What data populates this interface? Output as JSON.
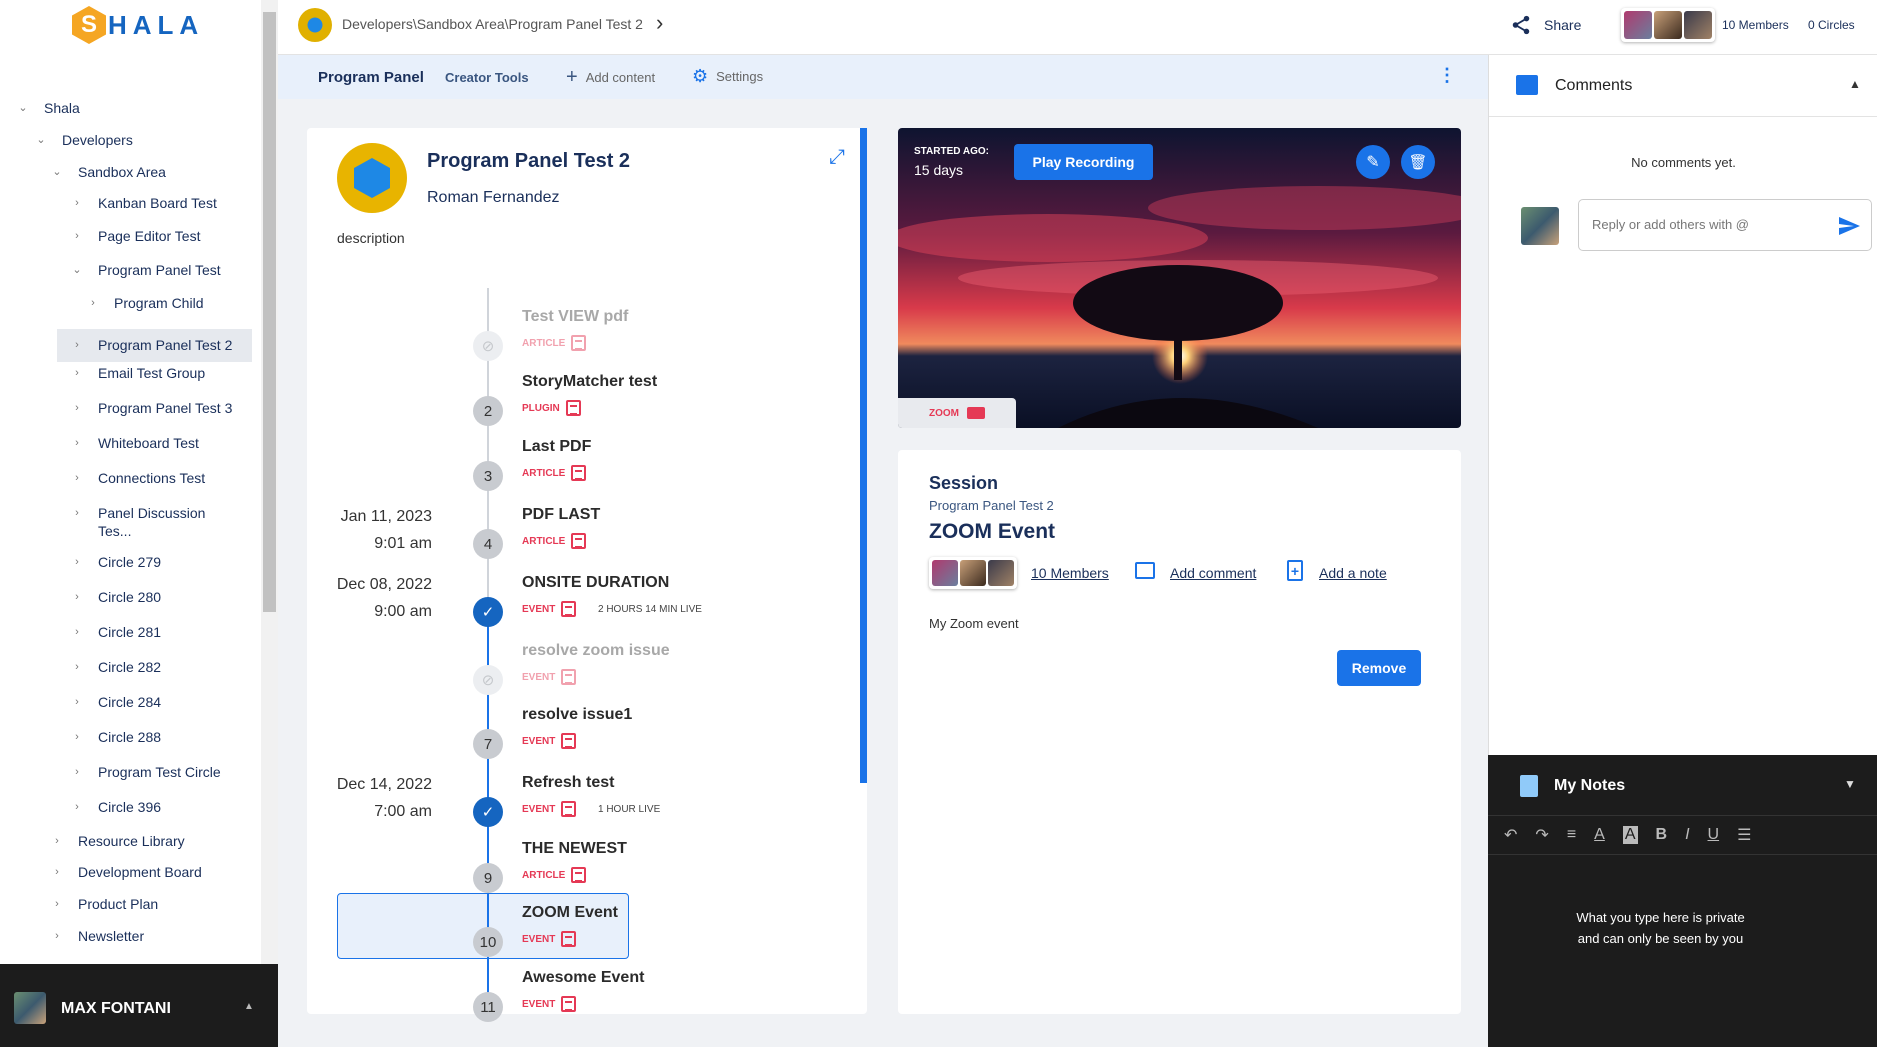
{
  "logo": {
    "mark": "S",
    "text": "HALA"
  },
  "sidebar": {
    "items": [
      {
        "label": "Shala",
        "chev": "⌄"
      },
      {
        "label": "Developers",
        "chev": "⌄"
      },
      {
        "label": "Sandbox Area",
        "chev": "⌄"
      },
      {
        "label": "Kanban Board Test",
        "chev": "›"
      },
      {
        "label": "Page Editor Test",
        "chev": "›"
      },
      {
        "label": "Program Panel Test",
        "chev": "⌄"
      },
      {
        "label": "Program Child",
        "chev": "›"
      },
      {
        "label": "Program Panel Test 2",
        "chev": "›"
      },
      {
        "label": "Email Test Group",
        "chev": "›"
      },
      {
        "label": "Program Panel Test 3",
        "chev": "›"
      },
      {
        "label": "Whiteboard Test",
        "chev": "›"
      },
      {
        "label": "Connections Test",
        "chev": "›"
      },
      {
        "label": "Panel Discussion Tes...",
        "chev": "›"
      },
      {
        "label": "Circle 279",
        "chev": "›"
      },
      {
        "label": "Circle 280",
        "chev": "›"
      },
      {
        "label": "Circle 281",
        "chev": "›"
      },
      {
        "label": "Circle 282",
        "chev": "›"
      },
      {
        "label": "Circle 284",
        "chev": "›"
      },
      {
        "label": "Circle 288",
        "chev": "›"
      },
      {
        "label": "Program Test Circle",
        "chev": "›"
      },
      {
        "label": "Circle 396",
        "chev": "›"
      },
      {
        "label": "Resource Library",
        "chev": "›"
      },
      {
        "label": "Development Board",
        "chev": "›"
      },
      {
        "label": "Product Plan",
        "chev": "›"
      },
      {
        "label": "Newsletter",
        "chev": "›"
      }
    ]
  },
  "user": {
    "name": "MAX FONTANI",
    "caret": "▲"
  },
  "topbar": {
    "breadcrumb": "Developers\\Sandbox Area\\Program Panel Test 2",
    "breadcrumb_chev": "›",
    "share": "Share",
    "members": "10 Members",
    "circles": "0 Circles"
  },
  "toolbar": {
    "tab_program_panel": "Program Panel",
    "tab_creator_tools": "Creator Tools",
    "add_content": "Add content",
    "settings": "Settings",
    "more": "⋮"
  },
  "program": {
    "title": "Program Panel Test 2",
    "author": "Roman Fernandez",
    "description": "description"
  },
  "timeline": [
    {
      "num": "",
      "title": "Test VIEW pdf",
      "type": "ARTICLE",
      "state": "hidden",
      "date": "",
      "time": "",
      "live": ""
    },
    {
      "num": "2",
      "title": "StoryMatcher test",
      "type": "PLUGIN",
      "state": "num",
      "date": "",
      "time": "",
      "live": ""
    },
    {
      "num": "3",
      "title": "Last PDF",
      "type": "ARTICLE",
      "state": "num",
      "date": "",
      "time": "",
      "live": ""
    },
    {
      "num": "4",
      "title": "PDF LAST",
      "type": "ARTICLE",
      "state": "num",
      "date": "Jan 11, 2023",
      "time": "9:01 am",
      "live": ""
    },
    {
      "num": "",
      "title": "ONSITE DURATION",
      "type": "EVENT",
      "state": "check",
      "date": "Dec 08, 2022",
      "time": "9:00 am",
      "live": "2 HOURS 14 MIN LIVE"
    },
    {
      "num": "",
      "title": "resolve zoom issue",
      "type": "EVENT",
      "state": "hidden",
      "date": "",
      "time": "",
      "live": ""
    },
    {
      "num": "7",
      "title": "resolve issue1",
      "type": "EVENT",
      "state": "num",
      "date": "",
      "time": "",
      "live": ""
    },
    {
      "num": "",
      "title": "Refresh test",
      "type": "EVENT",
      "state": "check",
      "date": "Dec 14, 2022",
      "time": "7:00 am",
      "live": "1 HOUR LIVE"
    },
    {
      "num": "9",
      "title": "THE NEWEST",
      "type": "ARTICLE",
      "state": "num",
      "date": "",
      "time": "",
      "live": ""
    },
    {
      "num": "10",
      "title": "ZOOM Event",
      "type": "EVENT",
      "state": "num",
      "date": "",
      "time": "",
      "live": ""
    },
    {
      "num": "11",
      "title": "Awesome Event",
      "type": "EVENT",
      "state": "num",
      "date": "",
      "time": "",
      "live": ""
    }
  ],
  "media": {
    "started_label": "STARTED AGO:",
    "started_value": "15 days",
    "play_button": "Play Recording",
    "zoom_tag": "ZOOM"
  },
  "session": {
    "heading": "Session",
    "subtitle": "Program Panel Test 2",
    "title": "ZOOM Event",
    "members": "10 Members",
    "add_comment": "Add comment",
    "add_note": "Add a note",
    "description": "My Zoom event",
    "remove": "Remove"
  },
  "comments": {
    "title": "Comments",
    "empty": "No comments yet.",
    "placeholder": "Reply or add others with @"
  },
  "notes": {
    "title": "My Notes",
    "hint_line1": "What you type here is private",
    "hint_line2": "and can only be seen by you"
  },
  "colors": {
    "accent": "#1a73e8",
    "brand": "#1565c0",
    "tag": "#e53955"
  }
}
